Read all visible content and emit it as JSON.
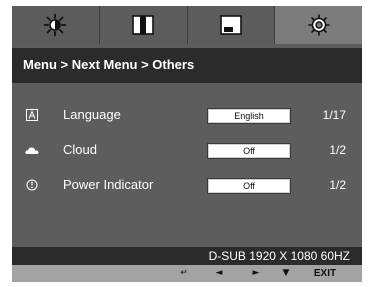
{
  "tabs": [
    {
      "icon": "brightness-icon"
    },
    {
      "icon": "contrast-picture-icon"
    },
    {
      "icon": "screen-position-icon"
    },
    {
      "icon": "settings-gear-icon",
      "active": true
    }
  ],
  "breadcrumb": "Menu > Next Menu > Others",
  "settings": [
    {
      "icon": "language-icon",
      "label": "Language",
      "value": "English",
      "count": "1/17"
    },
    {
      "icon": "cloud-icon",
      "label": "Cloud",
      "value": "Off",
      "count": "1/2"
    },
    {
      "icon": "power-indicator-icon",
      "label": "Power Indicator",
      "value": "Off",
      "count": "1/2"
    }
  ],
  "status": "D-SUB 1920 X 1080 60HZ",
  "navigation": {
    "select": "↵",
    "left": "◄",
    "right": "►",
    "down": "▼",
    "exit": "EXIT"
  },
  "colors": {
    "panel": "#5d5d5d",
    "tab_active": "#7c7c7c",
    "title_bar": "#2b2b2b",
    "nav_bar": "#a3a3a3"
  }
}
